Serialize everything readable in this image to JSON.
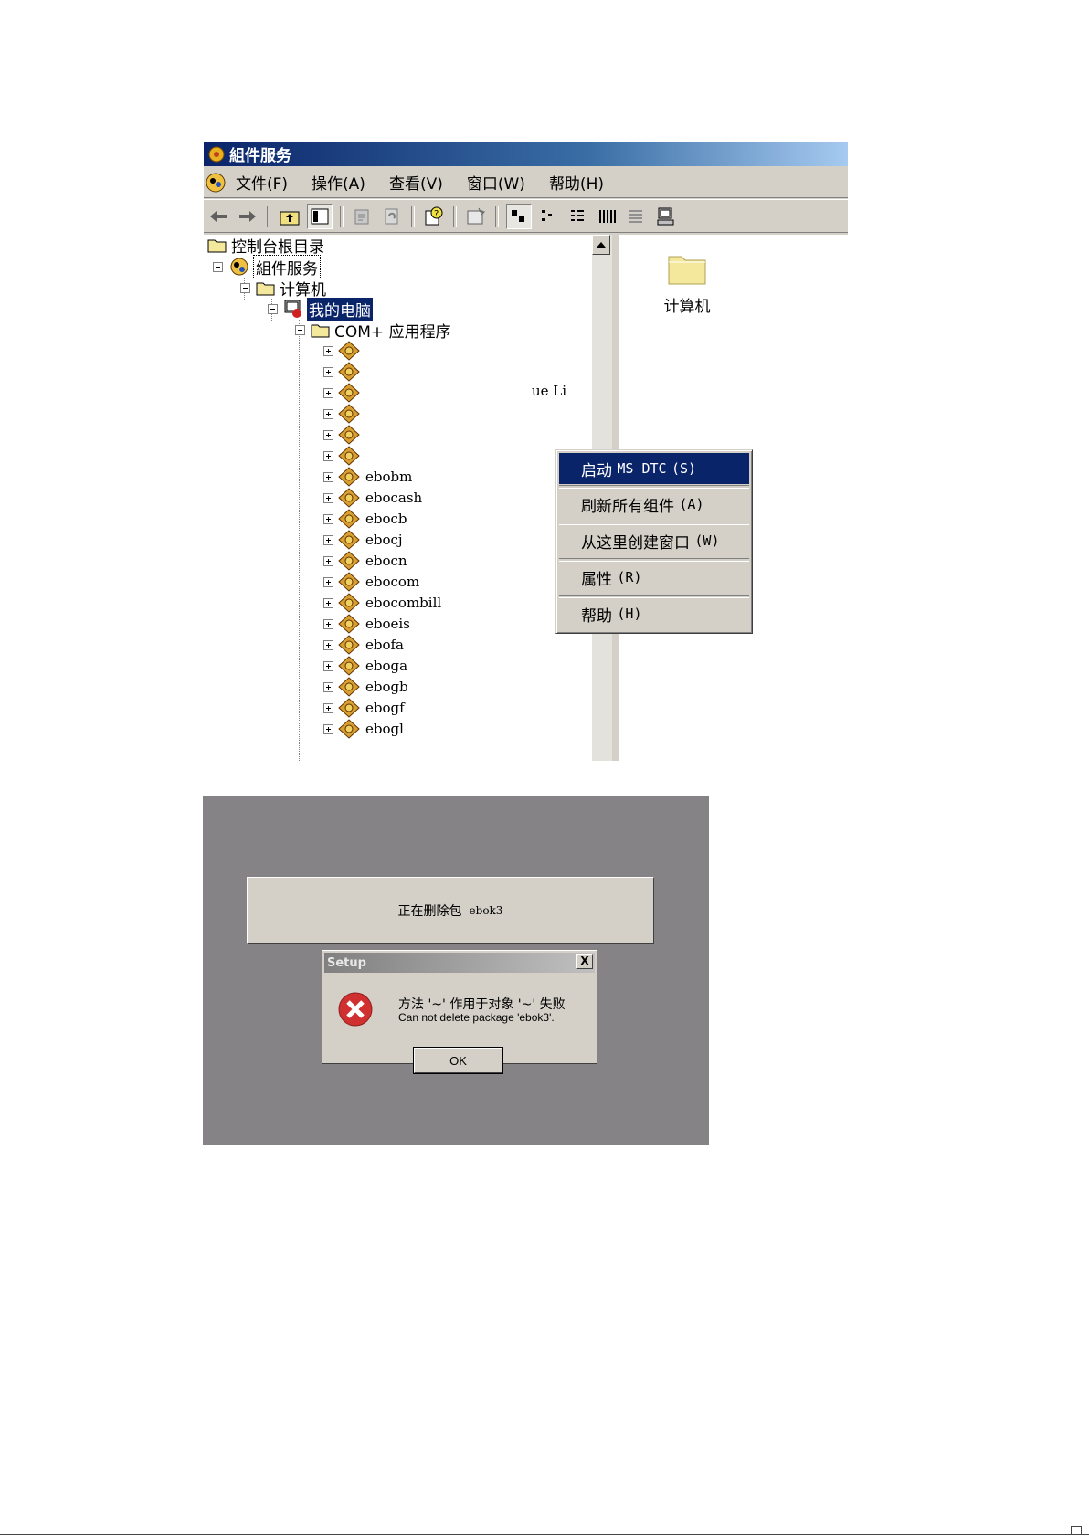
{
  "window1": {
    "title": "組件服务",
    "menu": [
      "文件(F)",
      "操作(A)",
      "查看(V)",
      "窗口(W)",
      "帮助(H)"
    ],
    "tree": {
      "root": "控制台根目录",
      "component_services": "組件服务",
      "computers": "计算机",
      "my_computer": "我的电脑",
      "com_apps": "COM+ 应用程序",
      "packages": [
        "ebobm",
        "ebocash",
        "ebocb",
        "ebocj",
        "ebocn",
        "ebocom",
        "ebocombill",
        "eboeis",
        "ebofa",
        "eboga",
        "ebogb",
        "ebogf",
        "ebogl"
      ],
      "partial_text": "ue Li"
    },
    "context_menu": [
      {
        "label_cn": "启动",
        "label_mono": "MS DTC",
        "accel": "(S)",
        "highlighted": true
      },
      {
        "label_cn": "刷新所有组件",
        "label_mono": "",
        "accel": "(A)",
        "highlighted": false
      },
      {
        "label_cn": "从这里创建窗口",
        "label_mono": "",
        "accel": "(W)",
        "highlighted": false
      },
      {
        "label_cn": "属性",
        "label_mono": "",
        "accel": "(R)",
        "highlighted": false
      },
      {
        "label_cn": "帮助",
        "label_mono": "",
        "accel": "(H)",
        "highlighted": false
      }
    ],
    "right_pane": {
      "folder_label": "计算机"
    }
  },
  "window2": {
    "progress_text": "正在删除包",
    "progress_pkg": "ebok3",
    "dialog": {
      "title": "Setup",
      "close": "X",
      "message_cn": "方法 '~' 作用于对象 '~' 失败",
      "message_en": "Can not delete package 'ebok3'.",
      "ok": "OK"
    }
  }
}
